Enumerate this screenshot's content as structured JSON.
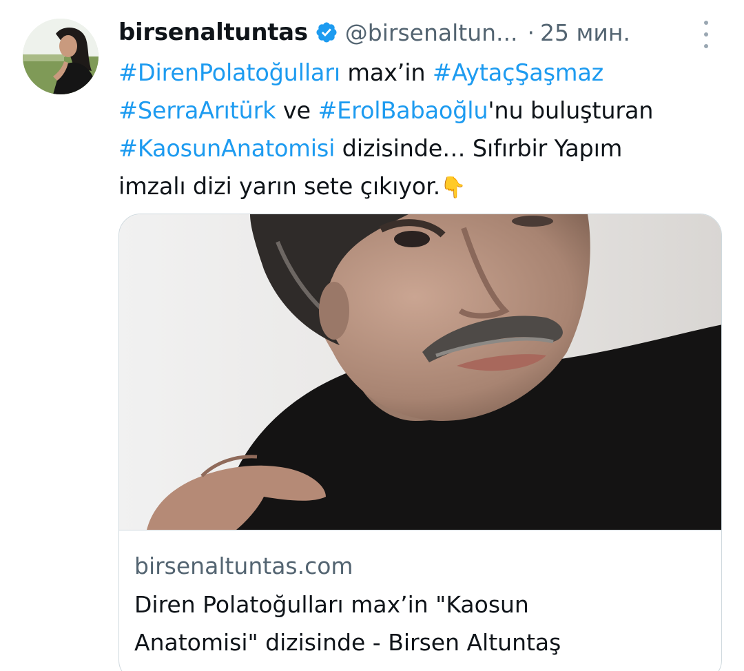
{
  "tweet": {
    "author_name": "birsenaltuntas",
    "author_handle": "@birsenaltun...",
    "separator": "·",
    "time": "25 мин.",
    "verified": true,
    "icons": {
      "avatar": "avatar-photo",
      "verified": "verified-badge-icon",
      "more": "more-options-icon",
      "emoji": "backhand-index-pointing-down"
    },
    "body": {
      "l1_tag1": "#DirenPolatoğulları",
      "l1_text": " max’in ",
      "l1_tag2": "#AytaçŞaşmaz",
      "l2_tag1": "#SerraArıtürk",
      "l2_text1": " ve ",
      "l2_tag2": "#ErolBabaoğlu",
      "l2_text2": "'nu buluşturan",
      "l3_tag1": "#KaosunAnatomisi",
      "l3_text": " dizisinde… Sıfırbir Yapım",
      "l4_text": "imzalı dizi yarın sete çıkıyor.",
      "l4_emoji": "👇"
    }
  },
  "card": {
    "domain": "birsenaltuntas.com",
    "title": "Diren Polatoğulları max’in \"Kaosun Anatomisi\" dizisinde - Birsen Altuntaş",
    "image": "portrait-photo"
  },
  "colors": {
    "text": "#0f1419",
    "secondary": "#536471",
    "link": "#1d9bf0",
    "border": "#cfd9de",
    "verified": "#1d9bf0"
  }
}
